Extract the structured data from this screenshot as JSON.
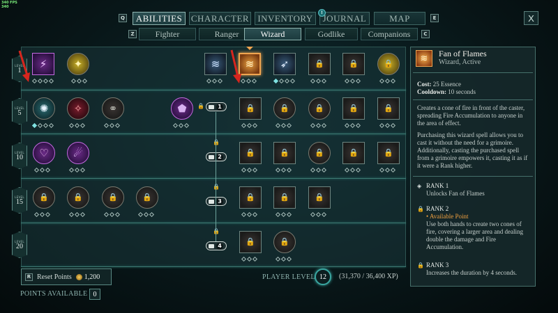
{
  "overlay": {
    "fps": "340 FPS",
    "fps_value": "340"
  },
  "nav": {
    "prev_key": "Q",
    "next_key": "E",
    "sub_prev_key": "Z",
    "sub_next_key": "C",
    "tabs": [
      "ABILITIES",
      "CHARACTER",
      "INVENTORY",
      "JOURNAL",
      "MAP"
    ],
    "active_tab": "ABILITIES",
    "journal_badge": "!",
    "close": "X",
    "subtabs": [
      "Fighter",
      "Ranger",
      "Wizard",
      "Godlike",
      "Companions"
    ],
    "active_subtab": "Wizard"
  },
  "tree": {
    "level_word": "LEVEL",
    "levels": [
      "1",
      "5",
      "10",
      "15",
      "20"
    ],
    "rank_requirements": [
      "1",
      "2",
      "3",
      "4"
    ],
    "skills": [
      {
        "id": "arcane-veil",
        "style": "purple",
        "glyph": "⚡",
        "locked": false,
        "pips_filled": 0
      },
      {
        "id": "minor-blights",
        "style": "gold",
        "glyph": "✦",
        "locked": false,
        "pips_filled": 0
      },
      {
        "id": "blast",
        "style": "blue",
        "glyph": "≋",
        "locked": false,
        "pips_filled": 0
      },
      {
        "id": "fan-of-flames",
        "style": "amber",
        "glyph": "≋",
        "locked": false,
        "pips_filled": 0,
        "selected": true
      },
      {
        "id": "ray-of-frost",
        "style": "blue",
        "glyph": "➶",
        "locked": false,
        "pips_filled": 1
      },
      {
        "id": "l1-locked-a",
        "style": "",
        "glyph": "",
        "locked": true,
        "pips_filled": 0
      },
      {
        "id": "l1-locked-b",
        "style": "",
        "glyph": "",
        "locked": true,
        "pips_filled": 0
      },
      {
        "id": "l1-locked-c",
        "style": "gold",
        "glyph": "",
        "locked": true,
        "pips_filled": 0
      }
    ]
  },
  "detail": {
    "title": "Fan of Flames",
    "subtitle": "Wizard, Active",
    "cost_label": "Cost:",
    "cost_value": "25 Essence",
    "cooldown_label": "Cooldown:",
    "cooldown_value": "10 seconds",
    "desc1": "Creates a cone of fire in front of the caster, spreading Fire Accumulation to anyone in the area of effect.",
    "desc2": "Purchasing this wizard spell allows you to cast it without the need for a grimoire. Additionally, casting the purchased spell from a grimoire empowers it, casting it as if it were a Rank higher.",
    "ranks": [
      {
        "title": "RANK 1",
        "status": "",
        "text": "Unlocks Fan of Flames"
      },
      {
        "title": "RANK 2",
        "status": "• Available Point",
        "text": "Use both hands to create two cones of fire, covering a larger area and dealing double the damage and Fire Accumulation."
      },
      {
        "title": "RANK 3",
        "status": "",
        "text": "Increases the duration by 4 seconds."
      }
    ]
  },
  "footer": {
    "reset_key": "R",
    "reset_label": "Reset Points",
    "reset_cost": "1,200",
    "points_label": "POINTS AVAILABLE",
    "points_value": "0",
    "player_level_label": "PLAYER LEVEL",
    "player_level": "12",
    "xp": "(31,370 / 36,400 XP)"
  },
  "colors": {
    "accent_orange": "#f0a550",
    "lock_orange": "#f0a040",
    "teal_line": "#3e7a73",
    "arrow_red": "#d6261e"
  }
}
